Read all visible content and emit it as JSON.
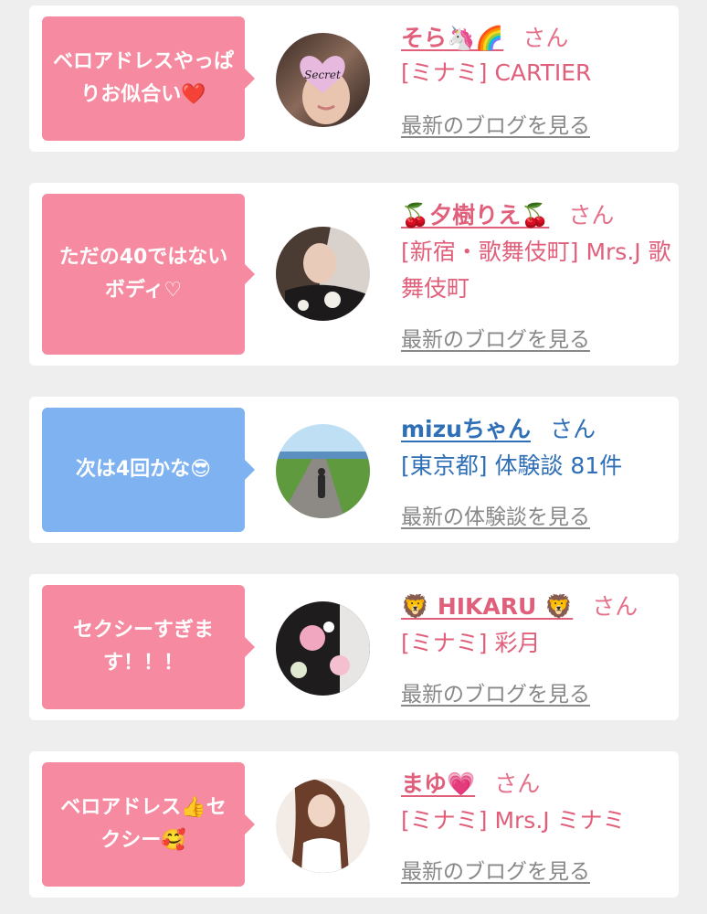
{
  "colors": {
    "pink_bubble": "#f58aa0",
    "blue_bubble": "#7fb2f0",
    "pink_text": "#e0607c",
    "blue_text": "#2f6fb6",
    "link_gray": "#888888"
  },
  "cards": [
    {
      "message": "ベロアドレスやっぱりお似合い❤️",
      "name": "そら🦄🌈",
      "honorific": "さん",
      "info": "[ミナミ] CARTIER",
      "link": "最新のブログを見る",
      "avatar_text": "Secret",
      "avatar_icon": "heart-secret-avatar-icon"
    },
    {
      "message": "ただの40ではないボディ♡",
      "name": "🍒夕樹りえ🍒",
      "honorific": "さん",
      "info": "[新宿・歌舞伎町] Mrs.J 歌舞伎町",
      "link": "最新のブログを見る",
      "avatar_icon": "woman-photo-avatar-icon"
    },
    {
      "message": "次は4回かな😎",
      "name": "mizuちゃん",
      "honorific": "さん",
      "info": "[東京都] 体験談 81件",
      "link": "最新の体験談を見る",
      "avatar_icon": "road-landscape-avatar-icon"
    },
    {
      "message": "セクシーすぎます！！！",
      "name": "🦁 HIKARU 🦁",
      "honorific": "さん",
      "info": "[ミナミ] 彩月",
      "link": "最新のブログを見る",
      "avatar_icon": "floral-dress-avatar-icon"
    },
    {
      "message": "ベロアドレス👍セクシー🥰",
      "name": "まゆ💗",
      "honorific": "さん",
      "info": "[ミナミ] Mrs.J ミナミ",
      "link": "最新のブログを見る",
      "avatar_icon": "long-hair-avatar-icon"
    }
  ]
}
